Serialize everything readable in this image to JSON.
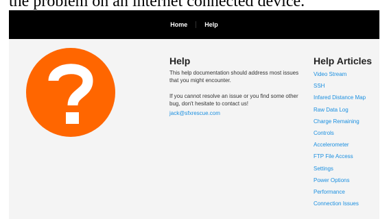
{
  "top_caption": "the problem on an internet connected device.",
  "nav": {
    "home_label": "Home",
    "help_label": "Help"
  },
  "help": {
    "title": "Help",
    "intro": "This help documentation should address most issues that you might encounter.",
    "contact_text": "If you cannot resolve an issue or you find some other bug, don't hesitate to contact us!",
    "email": "jack@sfxrescue.com",
    "icon": "question-mark-icon",
    "icon_color": "#ff6600"
  },
  "articles": {
    "title": "Help Articles",
    "items": [
      {
        "label": "Video Stream"
      },
      {
        "label": "SSH"
      },
      {
        "label": "Infared Distance Map"
      },
      {
        "label": "Raw Data Log"
      },
      {
        "label": "Charge Remaining"
      },
      {
        "label": "Controls"
      },
      {
        "label": "Accelerometer"
      },
      {
        "label": "FTP File Access"
      },
      {
        "label": "Settings"
      },
      {
        "label": "Power Options"
      },
      {
        "label": "Performance"
      },
      {
        "label": "Connection Issues"
      }
    ]
  },
  "colors": {
    "navbar": "#000000",
    "content_bg": "#f4f4f4",
    "link": "#1a8fe0",
    "accent": "#ff6600"
  }
}
